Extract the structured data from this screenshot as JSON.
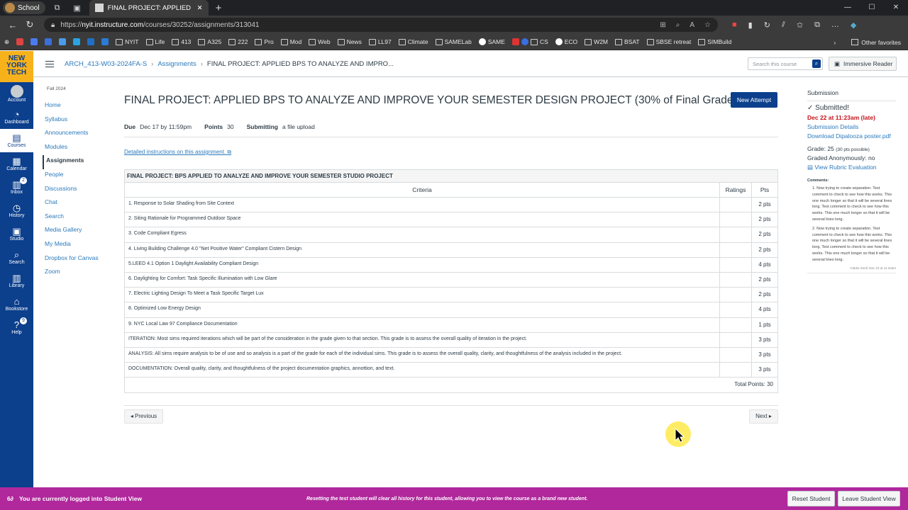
{
  "browser": {
    "profile_label": "School",
    "tab_title": "FINAL PROJECT: APPLIED BPS TO ANALYZE",
    "url_prefix": "https://",
    "url_domain": "nyit.instructure.com",
    "url_path": "/courses/30252/assignments/313041",
    "bookmarks": [
      "NYIT",
      "Life",
      "413",
      "A325",
      "222",
      "Pro",
      "Mod",
      "Web",
      "News",
      "LL97",
      "Climate",
      "SAMELab",
      "SAME",
      "CS",
      "ECO",
      "W2M",
      "BSAT",
      "SBSE retreat",
      "SIMBuild"
    ],
    "other_favorites": "Other favorites"
  },
  "global_nav": {
    "logo_line1": "NEW",
    "logo_line2": "YORK",
    "logo_line3": "TECH",
    "items": [
      {
        "label": "Account",
        "icon": "account-icon"
      },
      {
        "label": "Dashboard",
        "icon": "dashboard-icon"
      },
      {
        "label": "Courses",
        "icon": "courses-icon"
      },
      {
        "label": "Calendar",
        "icon": "calendar-icon"
      },
      {
        "label": "Inbox",
        "icon": "inbox-icon",
        "badge": "2"
      },
      {
        "label": "History",
        "icon": "history-icon"
      },
      {
        "label": "Studio",
        "icon": "studio-icon"
      },
      {
        "label": "Search",
        "icon": "search-icon"
      },
      {
        "label": "Library",
        "icon": "library-icon"
      },
      {
        "label": "Bookstore",
        "icon": "bookstore-icon"
      },
      {
        "label": "Help",
        "icon": "help-icon",
        "badge": "9"
      }
    ]
  },
  "header": {
    "breadcrumb": [
      "ARCH_413-W03-2024FA-S",
      "Assignments",
      "FINAL PROJECT: APPLIED BPS TO ANALYZE AND IMPRO..."
    ],
    "search_placeholder": "Search this course",
    "immersive_reader": "Immersive Reader"
  },
  "course_nav": {
    "term": "Fall 2024",
    "items": [
      "Home",
      "Syllabus",
      "Announcements",
      "Modules",
      "Assignments",
      "People",
      "Discussions",
      "Chat",
      "Search",
      "Media Gallery",
      "My Media",
      "Dropbox for Canvas",
      "Zoom"
    ],
    "active": "Assignments"
  },
  "assignment": {
    "title": "FINAL PROJECT: APPLIED BPS TO ANALYZE AND IMPROVE YOUR SEMESTER DESIGN PROJECT (30% of Final Grade)",
    "new_attempt": "New Attempt",
    "due_label": "Due",
    "due_value": "Dec 17 by 11:59pm",
    "points_label": "Points",
    "points_value": "30",
    "submitting_label": "Submitting",
    "submitting_value": "a file upload",
    "detail_link": "Detailed instructions on this assignment."
  },
  "rubric": {
    "title": "FINAL PROJECT: BPS APPLIED TO ANALYZE AND IMPROVE YOUR SEMESTER STUDIO PROJECT",
    "headers": {
      "criteria": "Criteria",
      "ratings": "Ratings",
      "pts": "Pts"
    },
    "rows": [
      {
        "criteria": "1. Response to Solar Shading from Site Context",
        "pts": "2 pts"
      },
      {
        "criteria": "2. Siting Rationale for Programmed Outdoor Space",
        "pts": "2 pts"
      },
      {
        "criteria": "3. Code Compliant Egress",
        "pts": "2 pts"
      },
      {
        "criteria": "4. Living Building Challenge 4.0 \"Net Positive Water\" Compliant Cistern Design",
        "pts": "2 pts"
      },
      {
        "criteria": "5.LEED 4.1 Option 1 Daylight Availability Compliant Design",
        "pts": "4 pts"
      },
      {
        "criteria": "6. Daylighting for Comfort: Task Specific Illumination with Low Glare",
        "pts": "2 pts"
      },
      {
        "criteria": "7. Electric Lighting Design To Meet a Task Specific Target Lux",
        "pts": "2 pts"
      },
      {
        "criteria": "8. Optimized Low Energy Design",
        "pts": "4 pts"
      },
      {
        "criteria": "9. NYC Local Law 97 Compliance Documentation",
        "pts": "1 pts"
      },
      {
        "criteria": "ITERATION: Most sims required iterations which will be part of the consideration in the grade given to that section. This grade is to assess the overall quality of iteration in the project.",
        "pts": "3 pts"
      },
      {
        "criteria": "ANALYSIS: All sims require analysis to be of use and so analysis is a part of the grade for each of the individual sims. This grade is to assess the overall quality, clarity, and thoughtfulness of the analysis included in the project.",
        "pts": "3 pts"
      },
      {
        "criteria": "DOCUMENTATION: Overall quality, clarity, and thoughtfulness of the project documentation graphics, annottion, and text.",
        "pts": "3 pts"
      }
    ],
    "total": "Total Points: 30"
  },
  "pager": {
    "previous": "◂ Previous",
    "next": "Next ▸"
  },
  "submission": {
    "heading": "Submission",
    "status": "Submitted!",
    "late": "Dec 22 at 11:23am (late)",
    "details_link": "Submission Details",
    "download_link": "Download Dipalooza poster.pdf",
    "grade": "Grade: 25",
    "grade_possible": "(30 pts possible)",
    "anon": "Graded Anonymously: no",
    "rubric_link": "View Rubric Evaluation",
    "comments_heading": "Comments:",
    "comments": [
      "1. Now trying to create separation. Test comment to check to see how this works. This one much longer so that it will be several lines long. Test comment to check to see how this works. This one much longer so that it will be several lines long.",
      "2. Now trying to create separation. Test comment to check to see how this works. This one much longer so that it will be several lines long. Test comment to check to see how this works. This one much longer so that it will be several lines long."
    ],
    "comment_author": "Clarke Snell, Dec 22 at 11:24am"
  },
  "student_view": {
    "message": "You are currently logged into Student View",
    "reset_note": "Resetting the test student will clear all history for this student, allowing you to view the course as a brand new student.",
    "reset_button": "Reset Student",
    "leave_button": "Leave Student View"
  },
  "colors": {
    "nav_blue": "#0c3f8c",
    "logo_gold": "#f6b11b",
    "banner_magenta": "#b0289c",
    "late_red": "#c4121b",
    "link_blue": "#2b7abc"
  }
}
